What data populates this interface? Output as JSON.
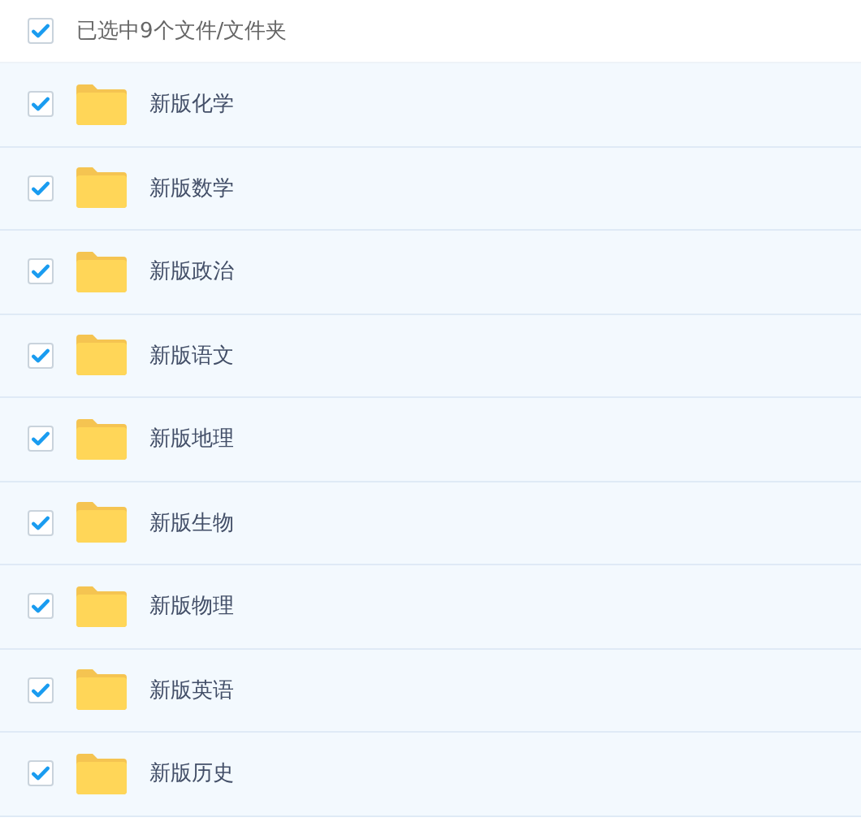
{
  "header": {
    "checked": true,
    "label": "已选中9个文件/文件夹"
  },
  "files": [
    {
      "name": "新版化学",
      "selected": true
    },
    {
      "name": "新版数学",
      "selected": true
    },
    {
      "name": "新版政治",
      "selected": true
    },
    {
      "name": "新版语文",
      "selected": true
    },
    {
      "name": "新版地理",
      "selected": true
    },
    {
      "name": "新版生物",
      "selected": true
    },
    {
      "name": "新版物理",
      "selected": true
    },
    {
      "name": "新版英语",
      "selected": true
    },
    {
      "name": "新版历史",
      "selected": true
    }
  ]
}
